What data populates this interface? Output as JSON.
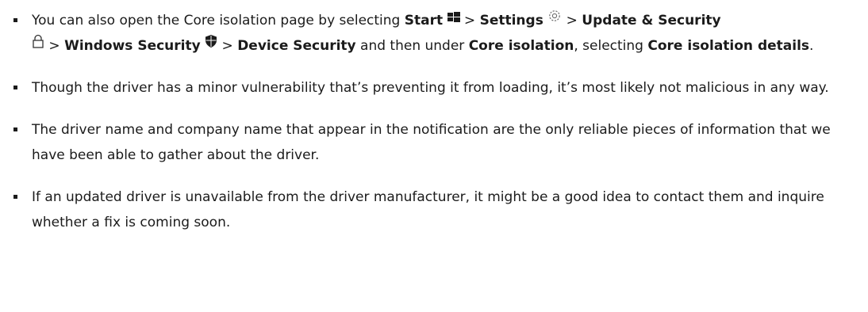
{
  "items": [
    {
      "parts": {
        "t1": "You can also open the Core isolation page by selecting ",
        "b1": "Start",
        "sep1": " > ",
        "b2": "Settings",
        "sep2": " > ",
        "b3": "Update & Security",
        "sep3": " > ",
        "b4": "Windows Security",
        "sep4": " > ",
        "b5": "Device Security",
        "t2": " and then under ",
        "b6": "Core isolation",
        "t3": ", selecting ",
        "b7": "Core isolation details",
        "t4": "."
      }
    },
    {
      "text": "Though the driver has a minor vulnerability that’s preventing it from loading, it’s most likely not malicious in any way."
    },
    {
      "text": "The driver name and company name that appear in the notification are the only reliable pieces of information that we have been able to gather about the driver."
    },
    {
      "text": "If an updated driver is unavailable from the driver manufacturer, it might be a good idea to contact them and inquire whether a fix is coming soon."
    }
  ],
  "icons": {
    "start": "windows-logo-icon",
    "settings": "gear-icon",
    "update": "lock-icon",
    "security": "shield-icon"
  }
}
